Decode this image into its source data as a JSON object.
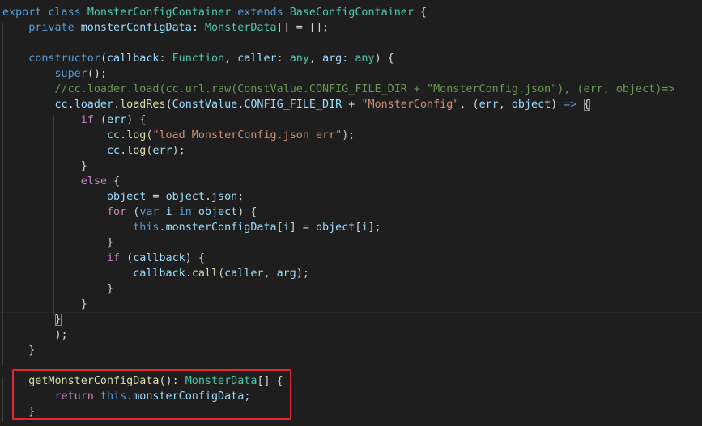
{
  "editor": {
    "language": "typescript",
    "colors": {
      "background": "#1e1e1e",
      "keyword": "#569cd6",
      "control": "#c586c0",
      "type": "#4ec9b0",
      "function": "#dcdcaa",
      "variable": "#9cdcfe",
      "string": "#ce9178",
      "comment": "#6a9955",
      "text": "#d4d4d4",
      "highlight_box": "#e0272b"
    },
    "code": {
      "l1": {
        "t1": "export",
        "t2": " ",
        "t3": "class",
        "t4": " ",
        "t5": "MonsterConfigContainer",
        "t6": " ",
        "t7": "extends",
        "t8": " ",
        "t9": "BaseConfigContainer",
        "t10": " {"
      },
      "l2": {
        "t1": "    ",
        "t2": "private",
        "t3": " ",
        "t4": "monsterConfigData",
        "t5": ": ",
        "t6": "MonsterData",
        "t7": "[] = [];"
      },
      "l3": {
        "t1": ""
      },
      "l4": {
        "t1": "    ",
        "t2": "constructor",
        "t3": "(",
        "t4": "callback",
        "t5": ": ",
        "t6": "Function",
        "t7": ", ",
        "t8": "caller",
        "t9": ": ",
        "t10": "any",
        "t11": ", ",
        "t12": "arg",
        "t13": ": ",
        "t14": "any",
        "t15": ") {"
      },
      "l5": {
        "t1": "        ",
        "t2": "super",
        "t3": "();"
      },
      "l6": {
        "t1": "        ",
        "t2": "//cc.loader.load(cc.url.raw(ConstValue.CONFIG_FILE_DIR + \"MonsterConfig.json\"), (err, object)=>"
      },
      "l7": {
        "t1": "        ",
        "t2": "cc",
        "t3": ".",
        "t4": "loader",
        "t5": ".",
        "t6": "loadRes",
        "t7": "(",
        "t8": "ConstValue",
        "t9": ".",
        "t10": "CONFIG_FILE_DIR",
        "t11": " + ",
        "t12": "\"MonsterConfig\"",
        "t13": ", (",
        "t14": "err",
        "t15": ", ",
        "t16": "object",
        "t17": ") ",
        "t18": "=>",
        "t19": " ",
        "t20": "{"
      },
      "l8": {
        "t1": "            ",
        "t2": "if",
        "t3": " (",
        "t4": "err",
        "t5": ") {"
      },
      "l9": {
        "t1": "                ",
        "t2": "cc",
        "t3": ".",
        "t4": "log",
        "t5": "(",
        "t6": "\"load MonsterConfig.json err\"",
        "t7": ");"
      },
      "l10": {
        "t1": "                ",
        "t2": "cc",
        "t3": ".",
        "t4": "log",
        "t5": "(",
        "t6": "err",
        "t7": ");"
      },
      "l11": {
        "t1": "            }"
      },
      "l12": {
        "t1": "            ",
        "t2": "else",
        "t3": " {"
      },
      "l13": {
        "t1": "                ",
        "t2": "object",
        "t3": " = ",
        "t4": "object",
        "t5": ".",
        "t6": "json",
        "t7": ";"
      },
      "l14": {
        "t1": "                ",
        "t2": "for",
        "t3": " (",
        "t4": "var",
        "t5": " ",
        "t6": "i",
        "t7": " ",
        "t8": "in",
        "t9": " ",
        "t10": "object",
        "t11": ") {"
      },
      "l15": {
        "t1": "                    ",
        "t2": "this",
        "t3": ".",
        "t4": "monsterConfigData",
        "t5": "[",
        "t6": "i",
        "t7": "] = ",
        "t8": "object",
        "t9": "[",
        "t10": "i",
        "t11": "];"
      },
      "l16": {
        "t1": "                }"
      },
      "l17": {
        "t1": "                ",
        "t2": "if",
        "t3": " (",
        "t4": "callback",
        "t5": ") {"
      },
      "l18": {
        "t1": "                    ",
        "t2": "callback",
        "t3": ".",
        "t4": "call",
        "t5": "(",
        "t6": "caller",
        "t7": ", ",
        "t8": "arg",
        "t9": ");"
      },
      "l19": {
        "t1": "                }"
      },
      "l20": {
        "t1": "            }"
      },
      "l21": {
        "t1": "        ",
        "t2": "}"
      },
      "l22": {
        "t1": "        );"
      },
      "l23": {
        "t1": "    }"
      },
      "l24": {
        "t1": ""
      },
      "l25": {
        "t1": "    ",
        "t2": "getMonsterConfigData",
        "t3": "(): ",
        "t4": "MonsterData",
        "t5": "[] {"
      },
      "l26": {
        "t1": "        ",
        "t2": "return",
        "t3": " ",
        "t4": "this",
        "t5": ".",
        "t6": "monsterConfigData",
        "t7": ";"
      },
      "l27": {
        "t1": "    }"
      }
    }
  }
}
